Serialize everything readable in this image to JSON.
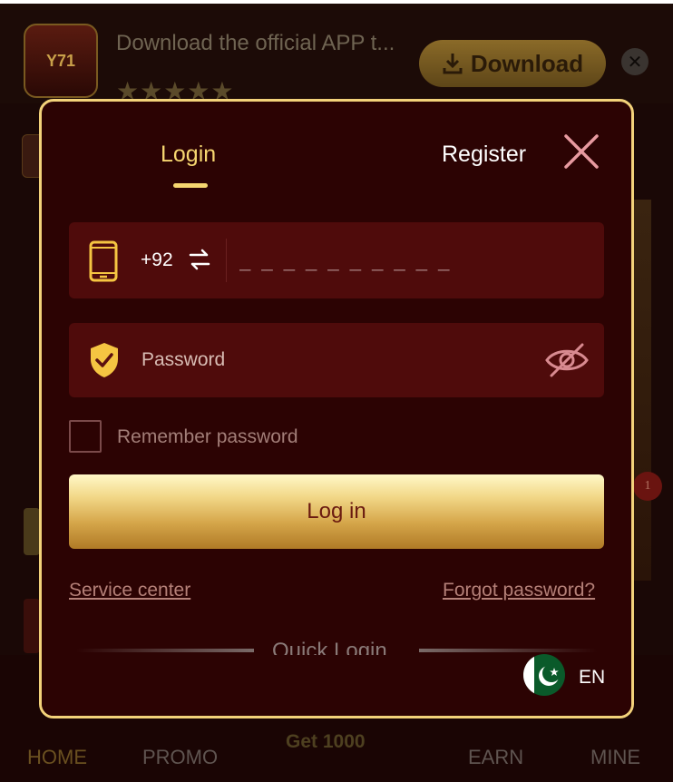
{
  "banner": {
    "logo_text": "Y71",
    "text": "Download the official APP t...",
    "stars": "★★★★★",
    "download_label": "Download",
    "close_glyph": "✕"
  },
  "background": {
    "side_badge": "1"
  },
  "bottom_nav": {
    "items": [
      "HOME",
      "PROMO",
      "Get 1000",
      "EARN",
      "MINE"
    ]
  },
  "modal": {
    "tabs": {
      "login": "Login",
      "register": "Register"
    },
    "phone": {
      "country_code": "+92",
      "placeholder": "_ _ _ _ _ _ _ _ _ _"
    },
    "password": {
      "placeholder": "Password"
    },
    "remember_label": "Remember password",
    "login_button": "Log in",
    "links": {
      "service": "Service center",
      "forgot": "Forgot password?"
    },
    "quick_login": "Quick Login",
    "language": "EN"
  },
  "colors": {
    "accent": "#f6d670",
    "modal_bg": "#2c0303",
    "field_bg": "#4f0b0b",
    "border": "#f3d27a"
  }
}
